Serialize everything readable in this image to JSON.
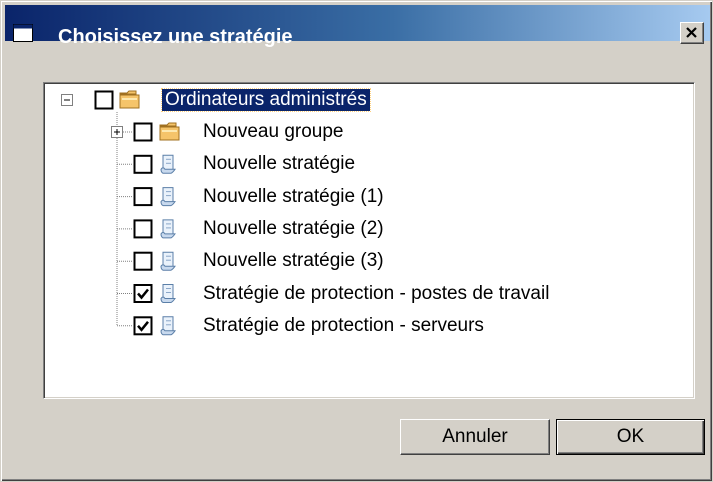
{
  "window": {
    "title": "Choisissez une stratégie"
  },
  "tree": {
    "root": {
      "label": "Ordinateurs administrés",
      "checked": false,
      "expanded": true,
      "icon": "folder-icon"
    },
    "children": [
      {
        "label": "Nouveau groupe",
        "checked": false,
        "icon": "folder-icon",
        "has_children": true
      },
      {
        "label": "Nouvelle stratégie",
        "checked": false,
        "icon": "policy-scroll-icon"
      },
      {
        "label": "Nouvelle stratégie (1)",
        "checked": false,
        "icon": "policy-scroll-icon"
      },
      {
        "label": "Nouvelle stratégie (2)",
        "checked": false,
        "icon": "policy-scroll-icon"
      },
      {
        "label": "Nouvelle stratégie (3)",
        "checked": false,
        "icon": "policy-scroll-icon"
      },
      {
        "label": "Stratégie de protection - postes de travail",
        "checked": true,
        "icon": "policy-scroll-icon"
      },
      {
        "label": "Stratégie de protection - serveurs",
        "checked": true,
        "icon": "policy-scroll-icon"
      }
    ]
  },
  "buttons": {
    "cancel": "Annuler",
    "ok": "OK"
  },
  "colors": {
    "title_bar": "#0a246a",
    "face": "#d4d0c8",
    "selection": "#0a246a",
    "folder": "#f5c46a"
  }
}
